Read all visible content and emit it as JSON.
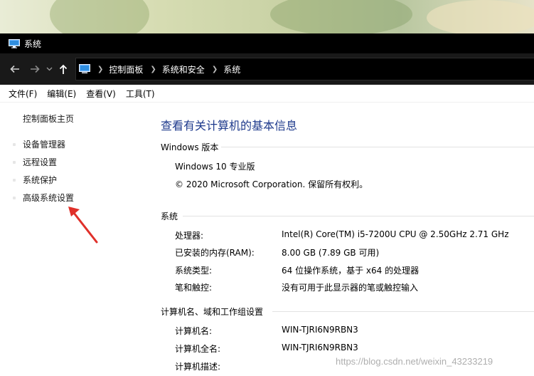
{
  "window": {
    "title": "系统",
    "app_icon": "monitor-icon"
  },
  "navigation": {
    "back_icon": "arrow-left-icon",
    "forward_icon": "arrow-right-icon",
    "recent_icon": "chevron-down-icon",
    "up_icon": "arrow-up-icon",
    "breadcrumb": [
      "控制面板",
      "系统和安全",
      "系统"
    ]
  },
  "menu": [
    "文件(F)",
    "编辑(E)",
    "查看(V)",
    "工具(T)"
  ],
  "sidebar": {
    "home": "控制面板主页",
    "links": [
      "设备管理器",
      "远程设置",
      "系统保护",
      "高级系统设置"
    ]
  },
  "main": {
    "title": "查看有关计算机的基本信息",
    "windows_edition": {
      "heading": "Windows 版本",
      "edition": "Windows 10 专业版",
      "copyright": "© 2020 Microsoft Corporation. 保留所有权利。"
    },
    "system": {
      "heading": "系统",
      "rows": [
        {
          "label": "处理器:",
          "value": "Intel(R) Core(TM) i5-7200U CPU @ 2.50GHz   2.71 GHz"
        },
        {
          "label": "已安装的内存(RAM):",
          "value": "8.00 GB (7.89 GB 可用)"
        },
        {
          "label": "系统类型:",
          "value": "64 位操作系统，基于 x64 的处理器"
        },
        {
          "label": "笔和触控:",
          "value": "没有可用于此显示器的笔或触控输入"
        }
      ]
    },
    "computer": {
      "heading": "计算机名、域和工作组设置",
      "rows": [
        {
          "label": "计算机名:",
          "value": "WIN-TJRI6N9RBN3"
        },
        {
          "label": "计算机全名:",
          "value": "WIN-TJRI6N9RBN3"
        },
        {
          "label": "计算机描述:",
          "value": ""
        }
      ]
    }
  },
  "watermark": "https://blog.csdn.net/weixin_43233219",
  "colors": {
    "title_blue": "#1e3a8c",
    "arrow_red": "#e0302a"
  }
}
